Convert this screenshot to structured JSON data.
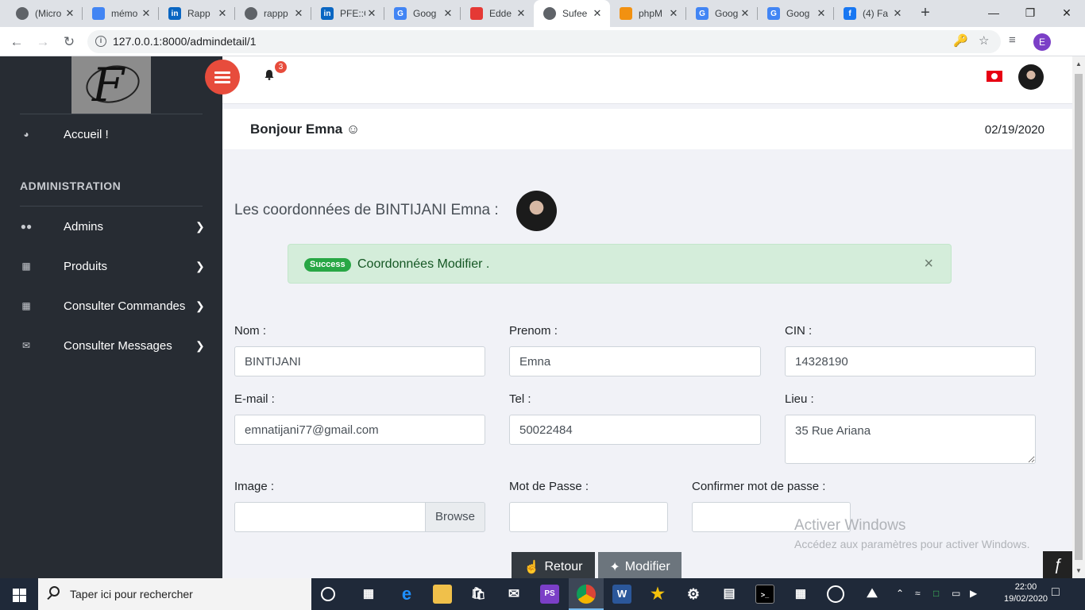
{
  "browser": {
    "tabs": [
      {
        "title": "(Micro",
        "icon": "globe-icon",
        "color": "#5f6368"
      },
      {
        "title": "mémo",
        "icon": "doc-icon",
        "color": "#4285f4"
      },
      {
        "title": "Rapp",
        "icon": "linkedin-icon",
        "color": "#0a66c2"
      },
      {
        "title": "rappp",
        "icon": "globe-icon",
        "color": "#5f6368"
      },
      {
        "title": "PFE::C",
        "icon": "linkedin-icon",
        "color": "#0a66c2"
      },
      {
        "title": "Goog",
        "icon": "google-translate-icon",
        "color": "#4285f4"
      },
      {
        "title": "Edde",
        "icon": "grid-icon",
        "color": "#e53935"
      },
      {
        "title": "Sufee",
        "icon": "globe-icon",
        "color": "#5f6368"
      },
      {
        "title": "phpM",
        "icon": "phpmyadmin-icon",
        "color": "#f29111"
      },
      {
        "title": "Goog",
        "icon": "google-translate-icon",
        "color": "#4285f4"
      },
      {
        "title": "Goog",
        "icon": "google-translate-icon",
        "color": "#4285f4"
      },
      {
        "title": "(4) Fa",
        "icon": "facebook-icon",
        "color": "#1877f2"
      }
    ],
    "active_tab": 7,
    "url": "127.0.0.1:8000/admindetail/1",
    "profile_initial": "E"
  },
  "sidebar": {
    "home": {
      "label": "Accueil !",
      "icon": "dashboard-icon"
    },
    "section_title": "ADMINISTRATION",
    "items": [
      {
        "label": "Admins",
        "icon": "users-icon"
      },
      {
        "label": "Produits",
        "icon": "gift-icon"
      },
      {
        "label": "Consulter Commandes",
        "icon": "grid-icon"
      },
      {
        "label": "Consulter Messages",
        "icon": "envelope-icon"
      }
    ]
  },
  "header": {
    "notification_count": "3"
  },
  "breadcrumb": {
    "greeting": "Bonjour Emna ☺",
    "date": "02/19/2020"
  },
  "main": {
    "title": "Les coordonnées de BINTIJANI Emna :",
    "alert": {
      "badge": "Success",
      "message": "Coordonnées Modifier .",
      "close": "×"
    },
    "form": {
      "nom": {
        "label": "Nom :",
        "value": "BINTIJANI"
      },
      "prenom": {
        "label": "Prenom :",
        "value": "Emna"
      },
      "cin": {
        "label": "CIN :",
        "value": "14328190"
      },
      "email": {
        "label": "E-mail :",
        "value": "emnatijani77@gmail.com"
      },
      "tel": {
        "label": "Tel :",
        "value": "50022484"
      },
      "lieu": {
        "label": "Lieu :",
        "value": "35 Rue Ariana"
      },
      "image": {
        "label": "Image :",
        "value": "",
        "browse": "Browse"
      },
      "password": {
        "label": "Mot de Passe :",
        "value": ""
      },
      "confirm": {
        "label": "Confirmer mot de passe :",
        "value": ""
      }
    },
    "buttons": {
      "back": "Retour",
      "save": "Modifier"
    }
  },
  "watermark": {
    "title": "Activer Windows",
    "subtitle": "Accédez aux paramètres pour activer Windows."
  },
  "taskbar": {
    "search_placeholder": "Taper ici pour rechercher",
    "time": "22:00",
    "date": "19/02/2020"
  },
  "colors": {
    "sidebar": "#272c33",
    "accent_red": "#e74c3c",
    "success_bg": "#d4edda",
    "success_text": "#155724"
  }
}
